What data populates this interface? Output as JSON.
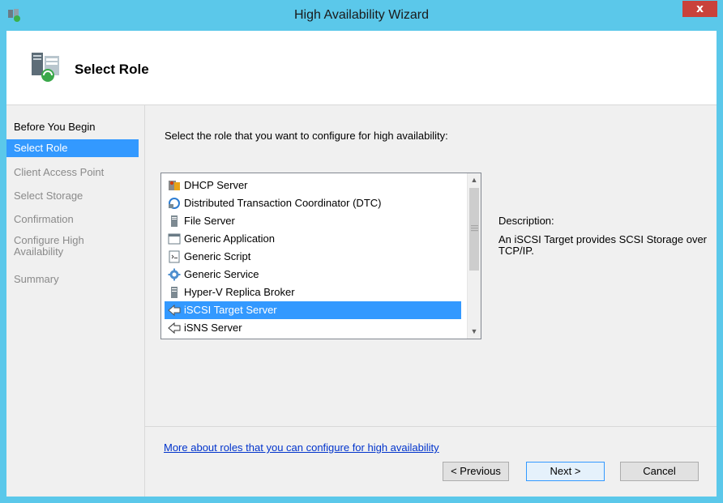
{
  "window": {
    "title": "High Availability Wizard",
    "close_glyph": "x",
    "app_icon": "cluster-wizard-icon"
  },
  "header": {
    "title": "Select Role",
    "icon": "role-servers-icon"
  },
  "nav": {
    "items": [
      {
        "label": "Before You Begin",
        "state": "done"
      },
      {
        "label": "Select Role",
        "state": "active"
      },
      {
        "label": "Client Access Point",
        "state": "pending"
      },
      {
        "label": "Select Storage",
        "state": "pending"
      },
      {
        "label": "Confirmation",
        "state": "pending"
      },
      {
        "label": "Configure High Availability",
        "state": "pending"
      },
      {
        "label": "Summary",
        "state": "pending"
      }
    ]
  },
  "main": {
    "instruction": "Select the role that you want to configure for high availability:",
    "roles": [
      {
        "label": "DHCP Server",
        "icon": "dhcp-icon"
      },
      {
        "label": "Distributed Transaction Coordinator (DTC)",
        "icon": "dtc-icon"
      },
      {
        "label": "File Server",
        "icon": "file-server-icon"
      },
      {
        "label": "Generic Application",
        "icon": "generic-application-icon"
      },
      {
        "label": "Generic Script",
        "icon": "generic-script-icon"
      },
      {
        "label": "Generic Service",
        "icon": "gear-icon"
      },
      {
        "label": "Hyper-V Replica Broker",
        "icon": "server-tower-icon"
      },
      {
        "label": "iSCSI Target Server",
        "icon": "iscsi-icon"
      },
      {
        "label": "iSNS Server",
        "icon": "isns-icon"
      }
    ],
    "selected_role": "iSCSI Target Server",
    "description_label": "Description:",
    "description_text": "An iSCSI Target provides SCSI Storage over TCP/IP.",
    "more_link": "More about roles that you can configure for high availability"
  },
  "buttons": {
    "previous": {
      "label": "< Previous"
    },
    "next": {
      "label": "Next >"
    },
    "cancel": {
      "label": "Cancel"
    }
  },
  "colors": {
    "titlebar": "#5bc8ea",
    "selection": "#3399ff",
    "close": "#c9423b",
    "link": "#0033cc"
  }
}
